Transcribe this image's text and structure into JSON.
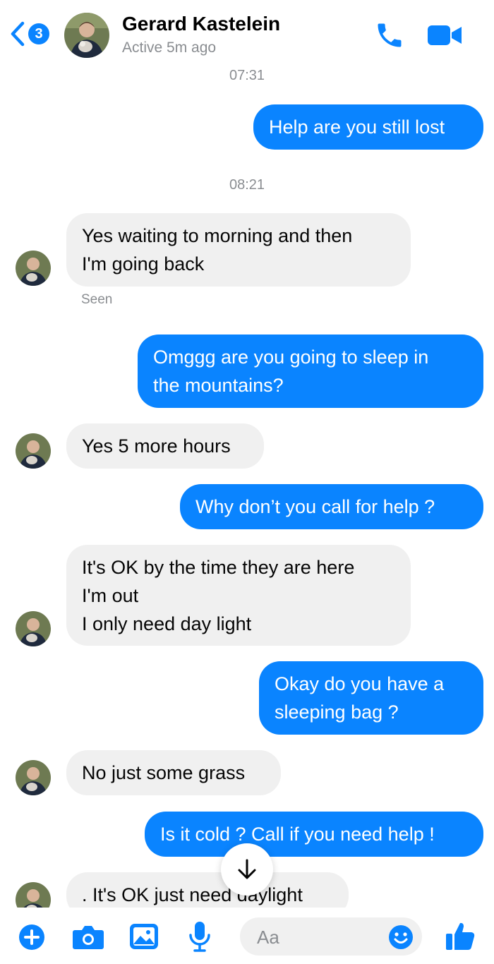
{
  "header": {
    "back_badge": "3",
    "contact_name": "Gerard Kastelein",
    "status": "Active 5m ago",
    "call_icon": "phone-icon",
    "video_icon": "video-camera-icon"
  },
  "colors": {
    "accent": "#0a84ff",
    "incoming_bubble": "#f0f0f0",
    "secondary_text": "#8a8d91"
  },
  "messages": [
    {
      "type": "timestamp",
      "text": "07:31"
    },
    {
      "type": "outgoing",
      "text": "Help are you still lost"
    },
    {
      "type": "timestamp",
      "text": "08:21"
    },
    {
      "type": "incoming",
      "text": "Yes waiting to morning and then\nI'm going back"
    },
    {
      "type": "status",
      "text": "Seen"
    },
    {
      "type": "outgoing",
      "text": "Omggg are you going to sleep in\nthe mountains?"
    },
    {
      "type": "incoming",
      "text": "Yes 5 more hours"
    },
    {
      "type": "outgoing",
      "text": "Why don’t you call for help ?"
    },
    {
      "type": "incoming",
      "text": "It's OK by the time they are here\nI'm out\nI only need day light"
    },
    {
      "type": "outgoing",
      "text": "Okay do you have a\nsleeping bag ?"
    },
    {
      "type": "incoming",
      "text": "No just some grass"
    },
    {
      "type": "outgoing",
      "text": "Is it cold ? Call if you need help !"
    },
    {
      "type": "incoming",
      "text": ". It's OK just need daylight"
    }
  ],
  "composer": {
    "placeholder": "Aa",
    "icons": [
      "plus-icon",
      "camera-icon",
      "gallery-icon",
      "microphone-icon",
      "emoji-icon",
      "thumbs-up-icon"
    ]
  }
}
